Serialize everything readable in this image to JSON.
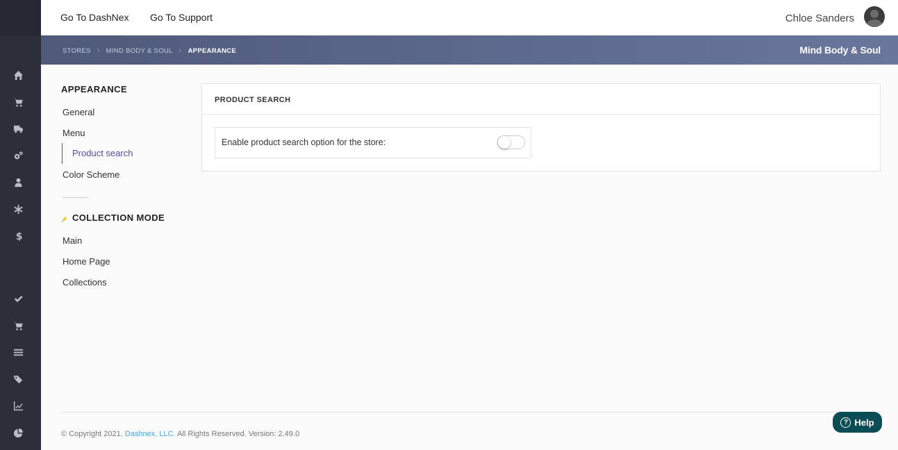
{
  "topnav": {
    "links": [
      "Go To DashNex",
      "Go To Support"
    ],
    "user_name": "Chloe Sanders"
  },
  "breadcrumb": {
    "items": [
      "STORES",
      "MIND BODY & SOUL",
      "APPEARANCE"
    ],
    "store_name": "Mind Body & Soul"
  },
  "sidebar_icons": [
    "home-icon",
    "cart-icon",
    "truck-icon",
    "gears-icon",
    "user-icon",
    "asterisk-icon",
    "dollar-icon",
    "check-icon",
    "cart-icon",
    "list-icon",
    "tags-icon",
    "chart-icon",
    "pie-chart-icon"
  ],
  "sidemenu": {
    "appearance_title": "APPEARANCE",
    "appearance_items": [
      "General",
      "Menu",
      "Product search",
      "Color Scheme"
    ],
    "active_item": "Product search",
    "collection_title": "COLLECTION MODE",
    "collection_items": [
      "Main",
      "Home Page",
      "Collections"
    ]
  },
  "card": {
    "title": "PRODUCT SEARCH",
    "option_label": "Enable product search option for the store:",
    "toggle_on": false
  },
  "footer": {
    "prefix": "© Copyright 2021.",
    "company": "Dashnex, LLC.",
    "suffix": "All Rights Reserved. Version: 2.49.0"
  },
  "help": {
    "label": "Help"
  },
  "colors": {
    "rail": "#2c2f3a",
    "accent": "#5b4a9b",
    "help": "#0b4d55",
    "link": "#4aa3df"
  }
}
